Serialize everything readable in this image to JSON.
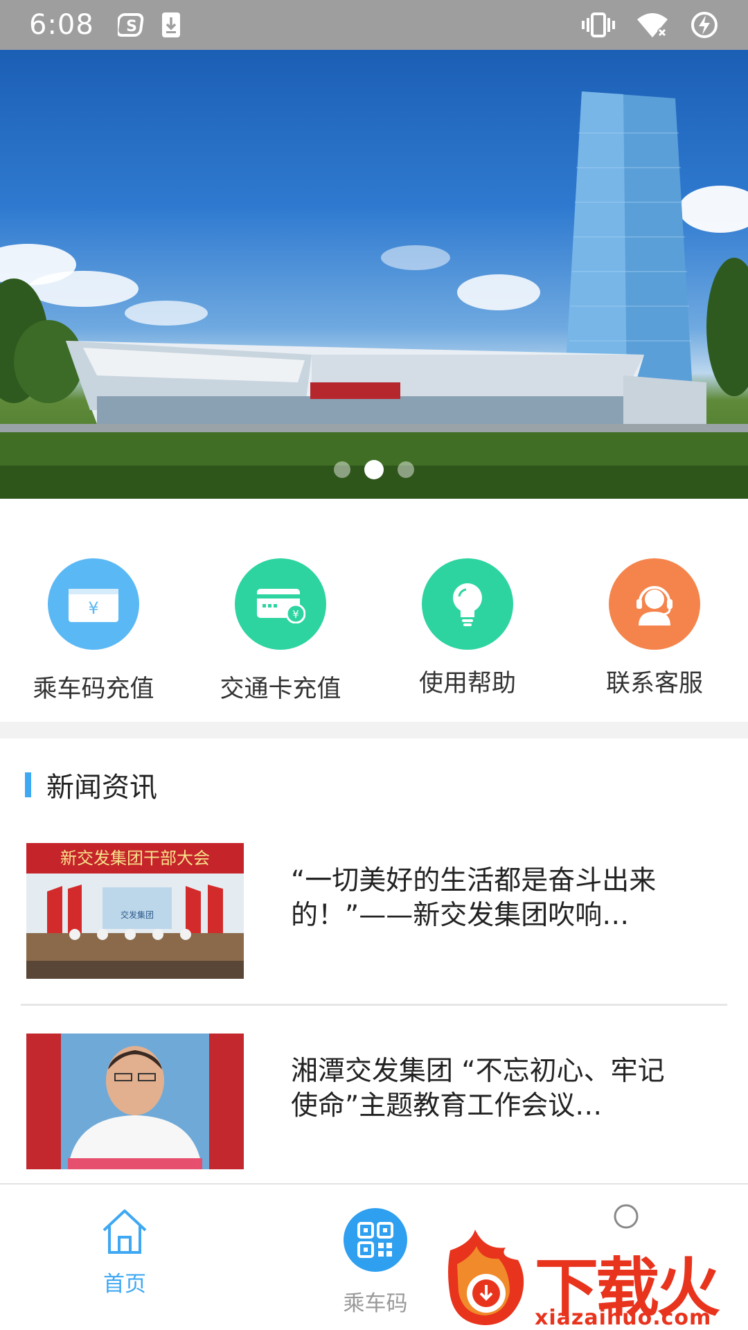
{
  "status_bar": {
    "time": "6:08",
    "left_icons": [
      "sogou-icon",
      "download-icon"
    ],
    "right_icons": [
      "vibrate-icon",
      "wifi-off-icon",
      "battery-charging-icon"
    ]
  },
  "banner": {
    "slide_count": 3,
    "active_index": 1
  },
  "quick_actions": [
    {
      "label": "乘车码充值",
      "icon": "yuan-card-icon",
      "color": "#5ab8f5"
    },
    {
      "label": "交通卡充值",
      "icon": "credit-card-icon",
      "color": "#2dd4a0"
    },
    {
      "label": "使用帮助",
      "icon": "lightbulb-icon",
      "color": "#2dd4a0"
    },
    {
      "label": "联系客服",
      "icon": "headset-icon",
      "color": "#f5844c"
    }
  ],
  "news": {
    "section_title": "新闻资讯",
    "items": [
      {
        "title": "“一切美好的生活都是奋斗出来的！”——新交发集团吹响…",
        "thumb_caption": "新交发集团干部大会",
        "thumb_sign": "交发集团"
      },
      {
        "title": "湘潭交发集团 “不忘初心、牢记使命”主题教育工作会议…"
      }
    ]
  },
  "bottom_nav": {
    "items": [
      {
        "label": "首页",
        "icon": "home-icon",
        "active": true
      },
      {
        "label": "乘车码",
        "icon": "qr-code-icon",
        "active": false
      },
      {
        "label": "",
        "icon": "circle-icon",
        "active": false
      }
    ],
    "active_color": "#3fa8f2",
    "inactive_color": "#999999"
  },
  "watermark": {
    "text": "下载火",
    "url": "xiazaihuo.com"
  }
}
